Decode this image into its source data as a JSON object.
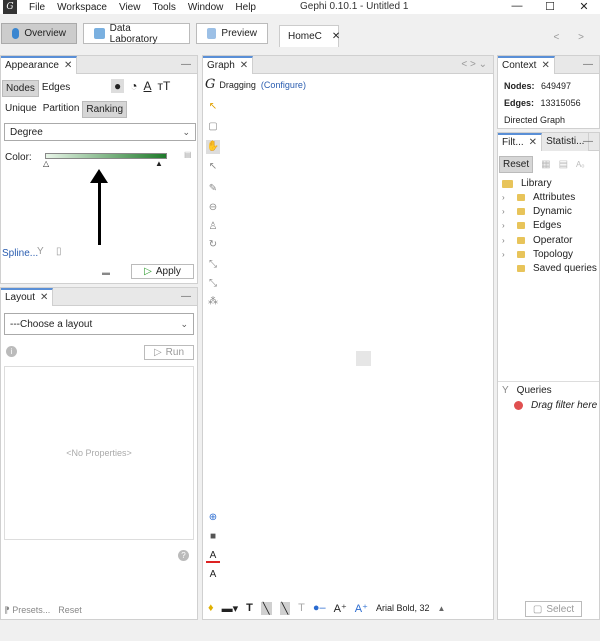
{
  "menubar": {
    "items": [
      "File",
      "Workspace",
      "View",
      "Tools",
      "Window",
      "Help"
    ],
    "title": "Gephi 0.10.1 - Untitled 1",
    "minimize": "—",
    "maximize": "☐",
    "close": "✕"
  },
  "toolbar": {
    "overview": "Overview",
    "data_lab": "Data Laboratory",
    "preview": "Preview",
    "home_tab": "HomeC",
    "tab_close": "✕"
  },
  "appearance": {
    "tab_label": "Appearance",
    "element_tabs": [
      "Nodes",
      "Edges"
    ],
    "mode_tabs": [
      "Unique",
      "Partition",
      "Ranking"
    ],
    "attribute_selected": "Degree",
    "color_label": "Color:",
    "spline_label": "Spline...",
    "apply_label": "Apply",
    "gradient_start": "#e8f5e8",
    "gradient_end": "#1e7a2a"
  },
  "layout": {
    "tab_label": "Layout",
    "choose": "---Choose a layout",
    "run": "Run",
    "no_props": "<No Properties>",
    "presets": "Presets...",
    "reset": "Reset"
  },
  "graph": {
    "tab_label": "Graph",
    "mode": "Dragging",
    "configure": "(Configure)",
    "font_label": "Arial Bold, 32"
  },
  "context": {
    "tab_label": "Context",
    "nodes_label": "Nodes:",
    "nodes_value": "649497",
    "edges_label": "Edges:",
    "edges_value": "13315056",
    "graph_type": "Directed Graph"
  },
  "filters": {
    "tab_filters": "Filt...",
    "tab_stats": "Statisti...",
    "reset": "Reset",
    "library": "Library",
    "items": [
      "Attributes",
      "Dynamic",
      "Edges",
      "Operator",
      "Topology",
      "Saved queries"
    ],
    "queries": "Queries",
    "drop_hint": "Drag filter here",
    "select": "Select"
  }
}
